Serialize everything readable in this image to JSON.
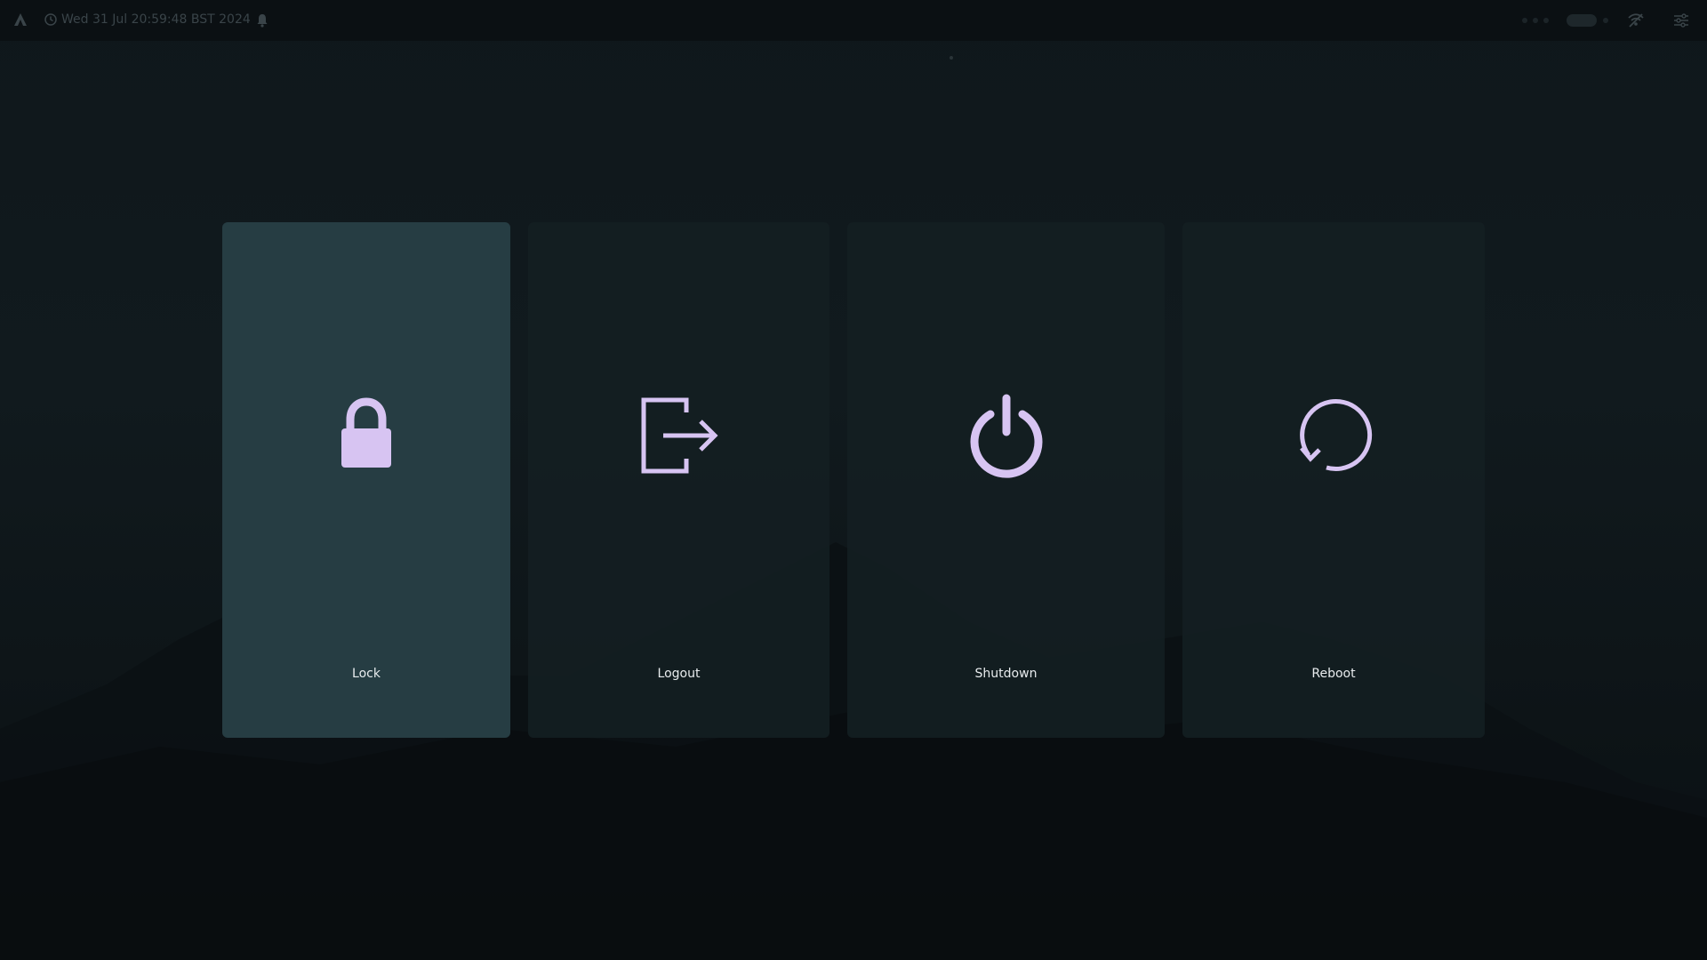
{
  "topbar": {
    "clock_text": "Wed 31 Jul 20:59:48 BST 2024",
    "icons": [
      "app-logo-icon",
      "clock-icon",
      "bell-icon",
      "network-icon",
      "settings-icon"
    ]
  },
  "menu": {
    "options": [
      {
        "label": "Lock",
        "icon": "lock-icon",
        "selected": true
      },
      {
        "label": "Logout",
        "icon": "logout-icon",
        "selected": false
      },
      {
        "label": "Shutdown",
        "icon": "power-icon",
        "selected": false
      },
      {
        "label": "Reboot",
        "icon": "reboot-icon",
        "selected": false
      }
    ]
  },
  "colors": {
    "icon_accent": "#d7c4f2",
    "selected_card": "#263d43",
    "card": "#141e22",
    "label_text": "#e8ecee"
  }
}
